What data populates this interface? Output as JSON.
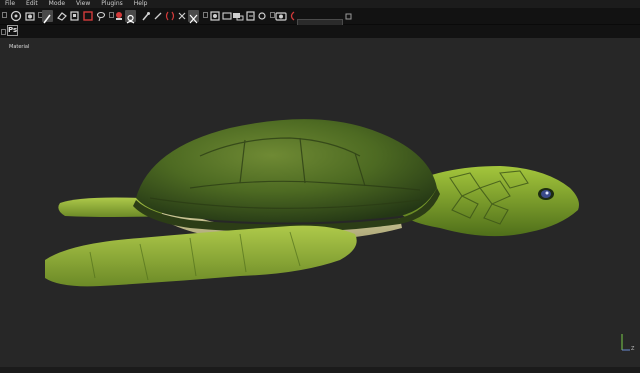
{
  "menu": [
    "File",
    "Edit",
    "Mode",
    "View",
    "Plugins",
    "Help"
  ],
  "toolbar": {
    "icons": [
      "grip-icon",
      "transform-icon",
      "camera-icon",
      "grip-icon",
      "brush-icon",
      "eraser-icon",
      "projection-icon",
      "square-color-icon",
      "lasso-icon",
      "grip-icon",
      "smudge-icon",
      "mask-icon",
      "eyedropper-icon",
      "symmetry-icon",
      "align-icon",
      "mirror-icon",
      "grip-icon",
      "viewport-icon",
      "display-icon",
      "render-icon",
      "grip-icon",
      "screenshot-icon",
      "history-icon",
      "slider-icon"
    ],
    "slider_value": ""
  },
  "secondbar": {
    "ps_label": "Ps"
  },
  "viewport": {
    "label": "Material",
    "axis_label": "Z"
  },
  "colors": {
    "background": "#272727",
    "toolbar": "#121212",
    "accent_red": "#d33a3a"
  }
}
